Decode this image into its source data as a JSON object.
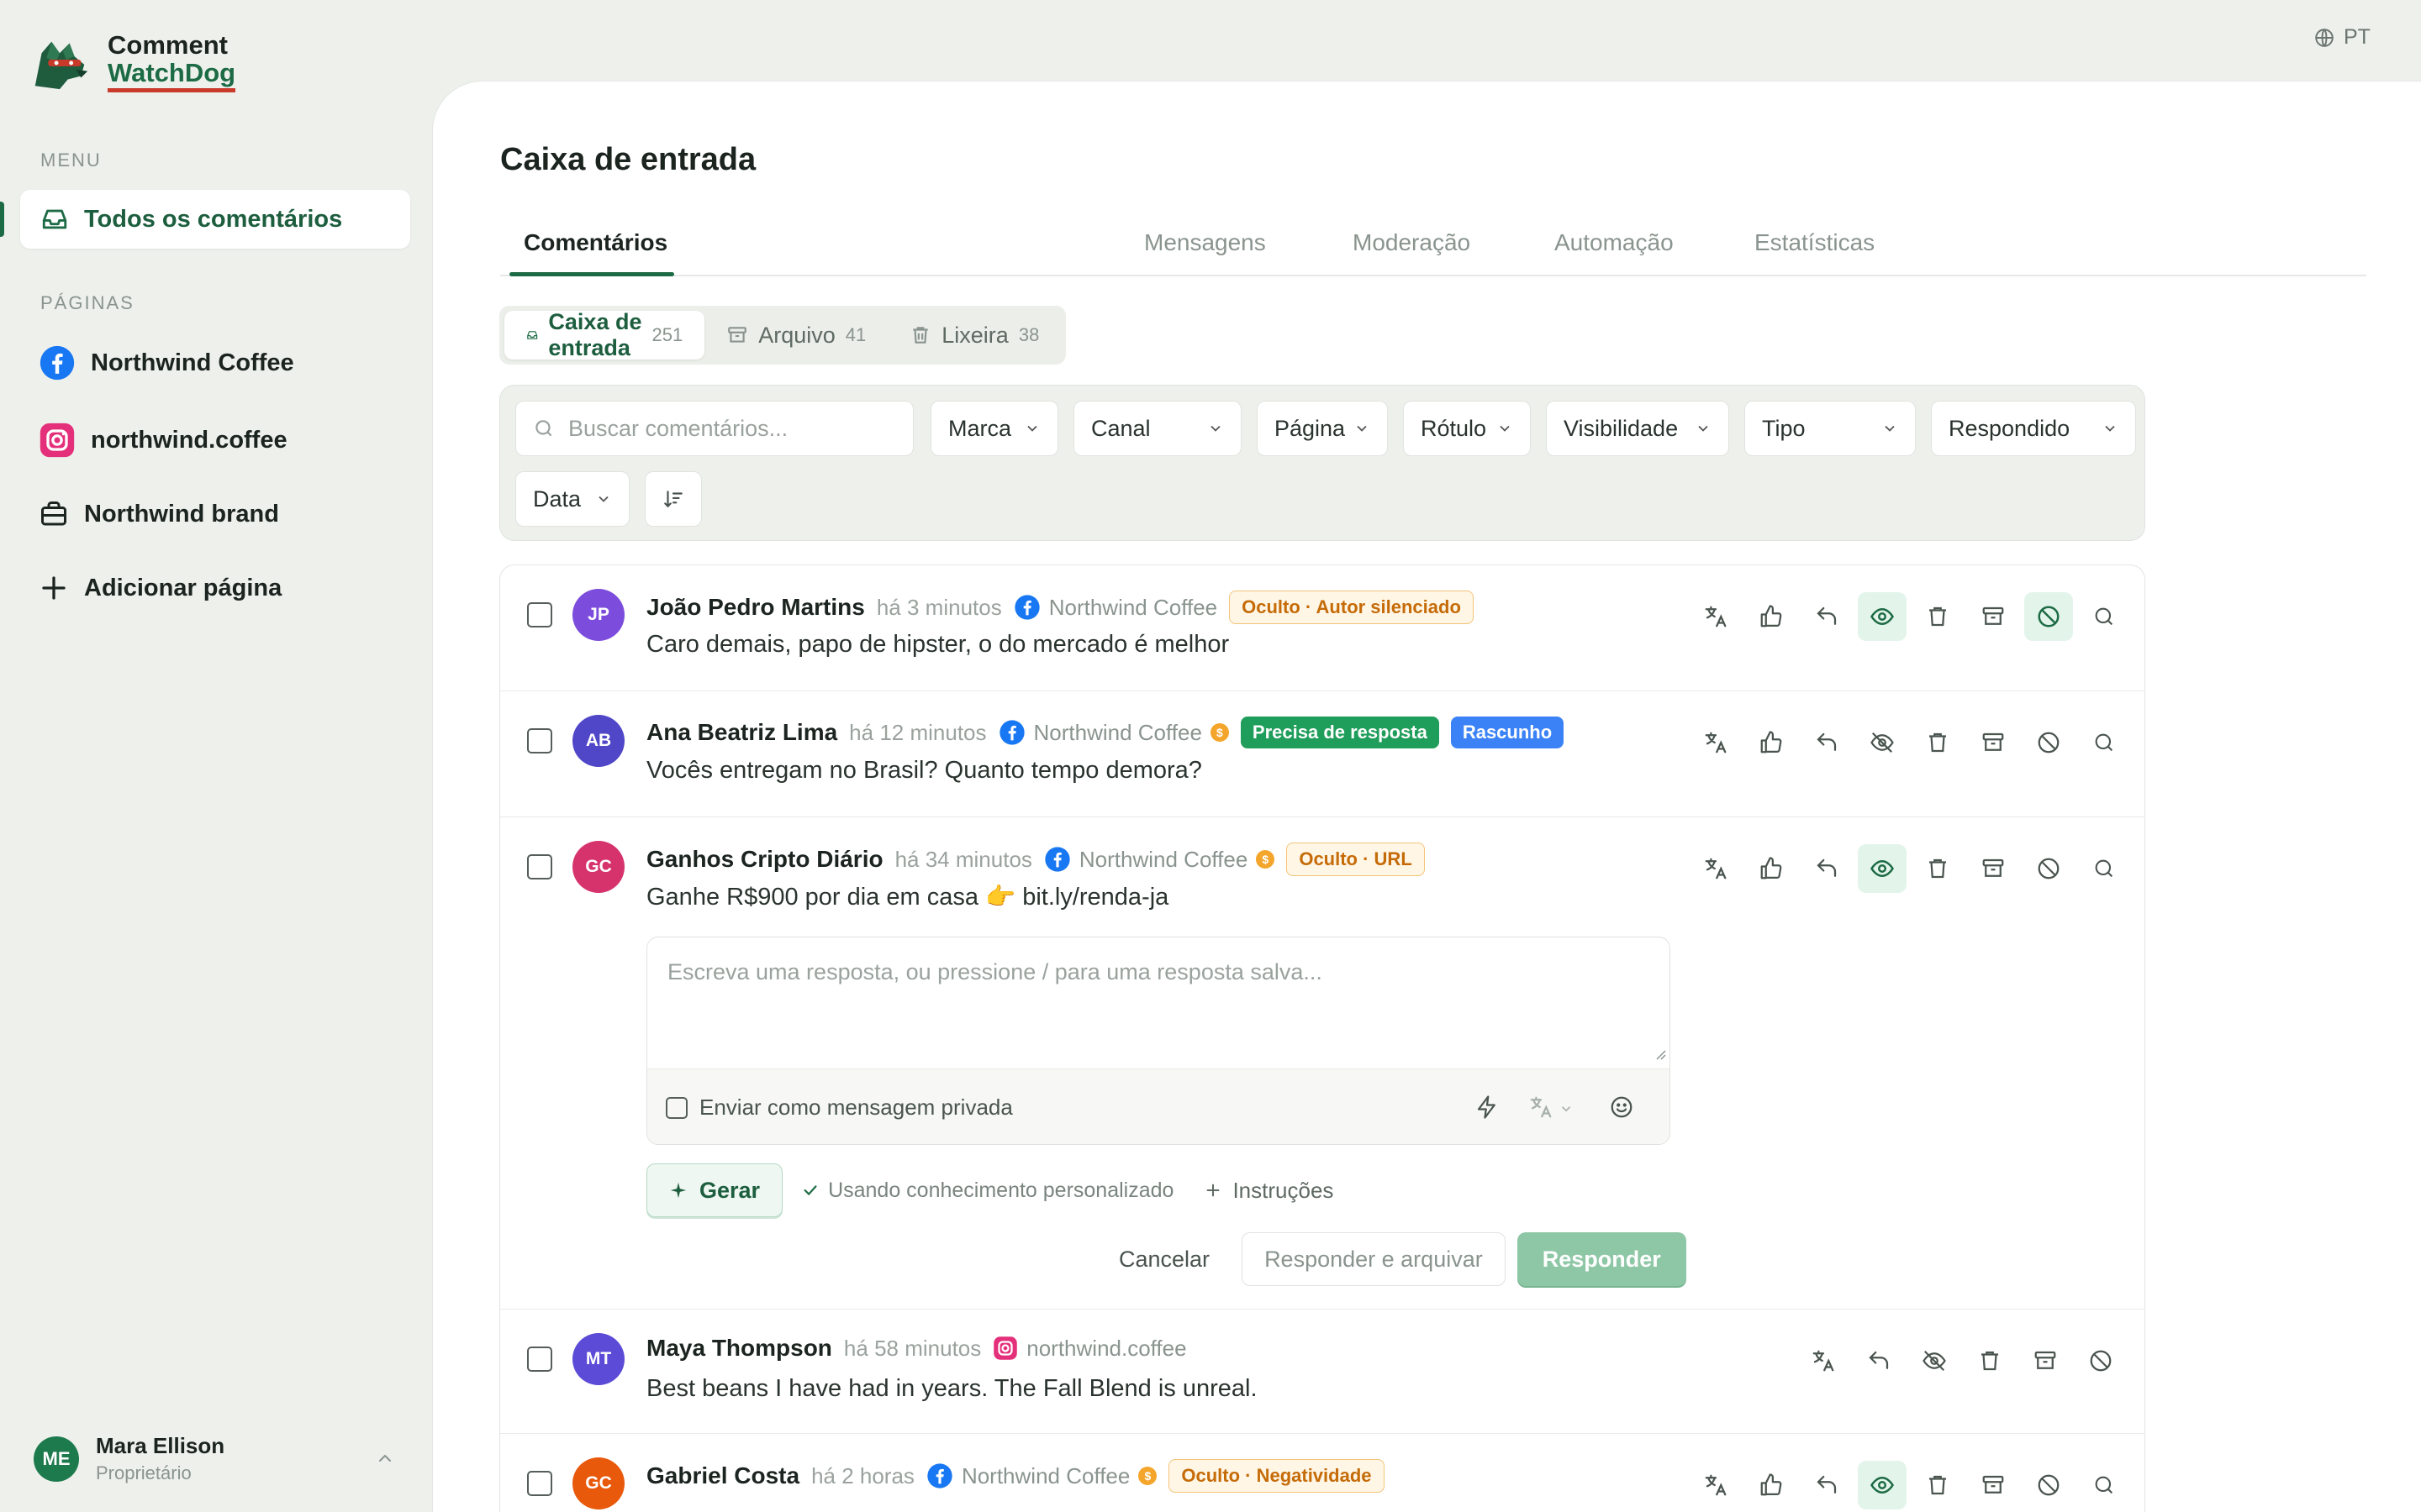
{
  "brand": {
    "line1": "Comment",
    "line2": "WatchDog"
  },
  "sidebar": {
    "menu_label": "MENU",
    "active_item": "Todos os comentários",
    "pages_label": "PÁGINAS",
    "pages": [
      {
        "label": "Northwind Coffee",
        "icon": "facebook-icon"
      },
      {
        "label": "northwind.coffee",
        "icon": "instagram-icon"
      },
      {
        "label": "Northwind brand",
        "icon": "briefcase-icon"
      },
      {
        "label": "Adicionar página",
        "icon": "plus-icon"
      }
    ],
    "user": {
      "initials": "ME",
      "name": "Mara Ellison",
      "role": "Proprietário"
    }
  },
  "lang": "PT",
  "main": {
    "title": "Caixa de entrada",
    "tabs": [
      "Comentários",
      "Mensagens",
      "Moderação",
      "Automação",
      "Estatísticas"
    ],
    "subtabs": [
      {
        "label": "Caixa de entrada",
        "count": "251"
      },
      {
        "label": "Arquivo",
        "count": "41"
      },
      {
        "label": "Lixeira",
        "count": "38"
      }
    ],
    "search_placeholder": "Buscar comentários...",
    "filters": [
      "Marca",
      "Canal",
      "Página",
      "Rótulo",
      "Visibilidade",
      "Tipo",
      "Respondido",
      "Data"
    ]
  },
  "comments": [
    {
      "initials": "JP",
      "author": "João Pedro Martins",
      "time": "há 3 minutos",
      "source": "Northwind Coffee",
      "badges": [
        "Oculto · Autor silenciado"
      ],
      "text": "Caro demais, papo de hipster, o do mercado é melhor"
    },
    {
      "initials": "AB",
      "author": "Ana Beatriz Lima",
      "time": "há 12 minutos",
      "source": "Northwind Coffee",
      "badges": [
        "Precisa de resposta",
        "Rascunho"
      ],
      "text": "Vocês entregam no Brasil? Quanto tempo demora?"
    },
    {
      "initials": "GC",
      "author": "Ganhos Cripto Diário",
      "time": "há 34 minutos",
      "source": "Northwind Coffee",
      "badges": [
        "Oculto · URL"
      ],
      "text": "Ganhe R$900 por dia em casa 👉 bit.ly/renda-ja"
    },
    {
      "initials": "MT",
      "author": "Maya Thompson",
      "time": "há 58 minutos",
      "source": "northwind.coffee",
      "badges": [],
      "text": "Best beans I have had in years. The Fall Blend is unreal."
    },
    {
      "initials": "GC",
      "author": "Gabriel Costa",
      "time": "há 2 horas",
      "source": "Northwind Coffee",
      "badges": [
        "Oculto · Negatividade"
      ],
      "text": ""
    }
  ],
  "reply": {
    "placeholder": "Escreva uma resposta, ou pressione / para uma resposta salva...",
    "private_label": "Enviar como mensagem privada",
    "generate": "Gerar",
    "using_knowledge": "Usando conhecimento personalizado",
    "instructions": "Instruções",
    "cancel": "Cancelar",
    "reply_archive": "Responder e arquivar",
    "reply": "Responder"
  },
  "colors": {
    "accent": "#1d6b45",
    "primary_button": "#8ec7a6",
    "facebook": "#1877f2",
    "instagram": "#e4307a"
  }
}
